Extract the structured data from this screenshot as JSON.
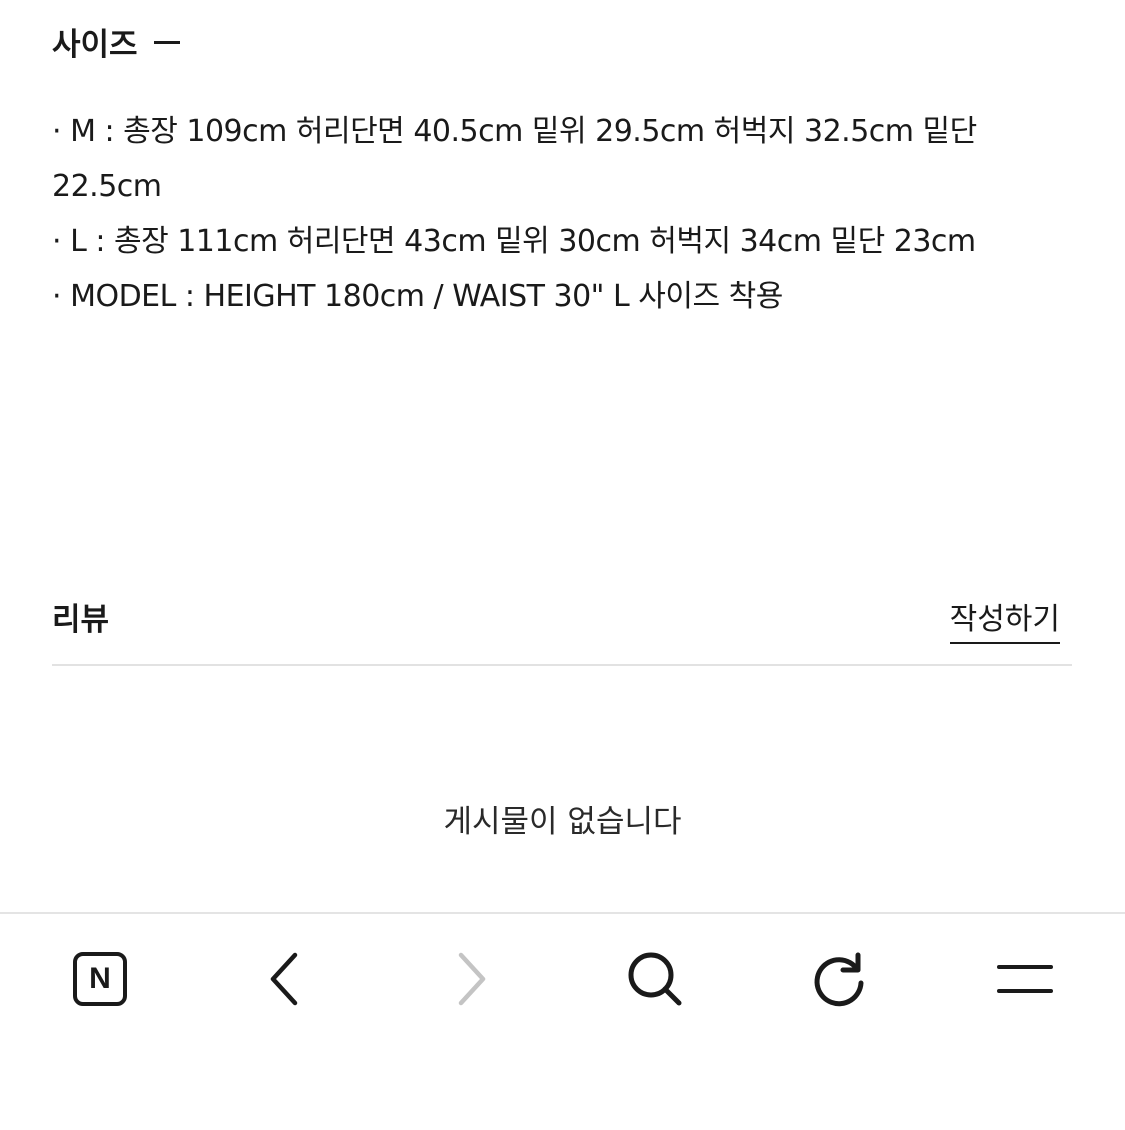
{
  "size_section": {
    "title": "사이즈",
    "lines": [
      "· M : 총장 109cm 허리단면 40.5cm 밑위 29.5cm 허벅지 32.5cm 밑단 22.5cm",
      "· L : 총장 111cm 허리단면 43cm 밑위 30cm 허벅지 34cm 밑단 23cm",
      "· MODEL : HEIGHT 180cm / WAIST 30\" L 사이즈 착용"
    ]
  },
  "review_section": {
    "title": "리뷰",
    "write_label": "작성하기",
    "empty_message": "게시물이 없습니다"
  },
  "bottom_nav": {
    "home_letter": "N",
    "items": [
      {
        "name": "naver-home-icon"
      },
      {
        "name": "back-chevron-icon"
      },
      {
        "name": "forward-chevron-icon"
      },
      {
        "name": "search-icon"
      },
      {
        "name": "refresh-icon"
      },
      {
        "name": "menu-icon"
      }
    ],
    "colors": {
      "active": "#1a1a1a",
      "disabled": "#c4c4c4"
    }
  }
}
